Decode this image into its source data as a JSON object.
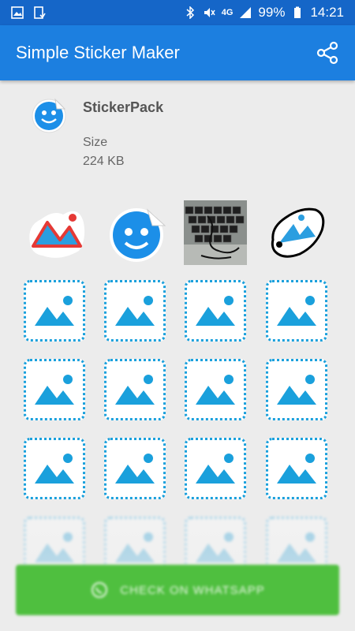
{
  "status_bar": {
    "battery_percent": "99%",
    "time": "14:21",
    "network": "4G"
  },
  "app_bar": {
    "title": "Simple Sticker Maker",
    "share_icon": "share-icon"
  },
  "pack": {
    "name": "StickerPack",
    "size_label": "Size",
    "size_value": "224 KB"
  },
  "stickers": [
    {
      "name": "sticker-mountain-red"
    },
    {
      "name": "sticker-smiley-blue"
    },
    {
      "name": "sticker-keyboard-photo"
    },
    {
      "name": "sticker-drawn-blob"
    }
  ],
  "empty_slot_icon": "image-placeholder-icon",
  "bottom_button": {
    "label": "CHECK ON WHATSAPP",
    "icon": "whatsapp-icon",
    "color": "#4fbf3f"
  },
  "colors": {
    "status_bar": "#1566c8",
    "app_bar": "#1c7fe0",
    "accent": "#1aa0dc"
  }
}
